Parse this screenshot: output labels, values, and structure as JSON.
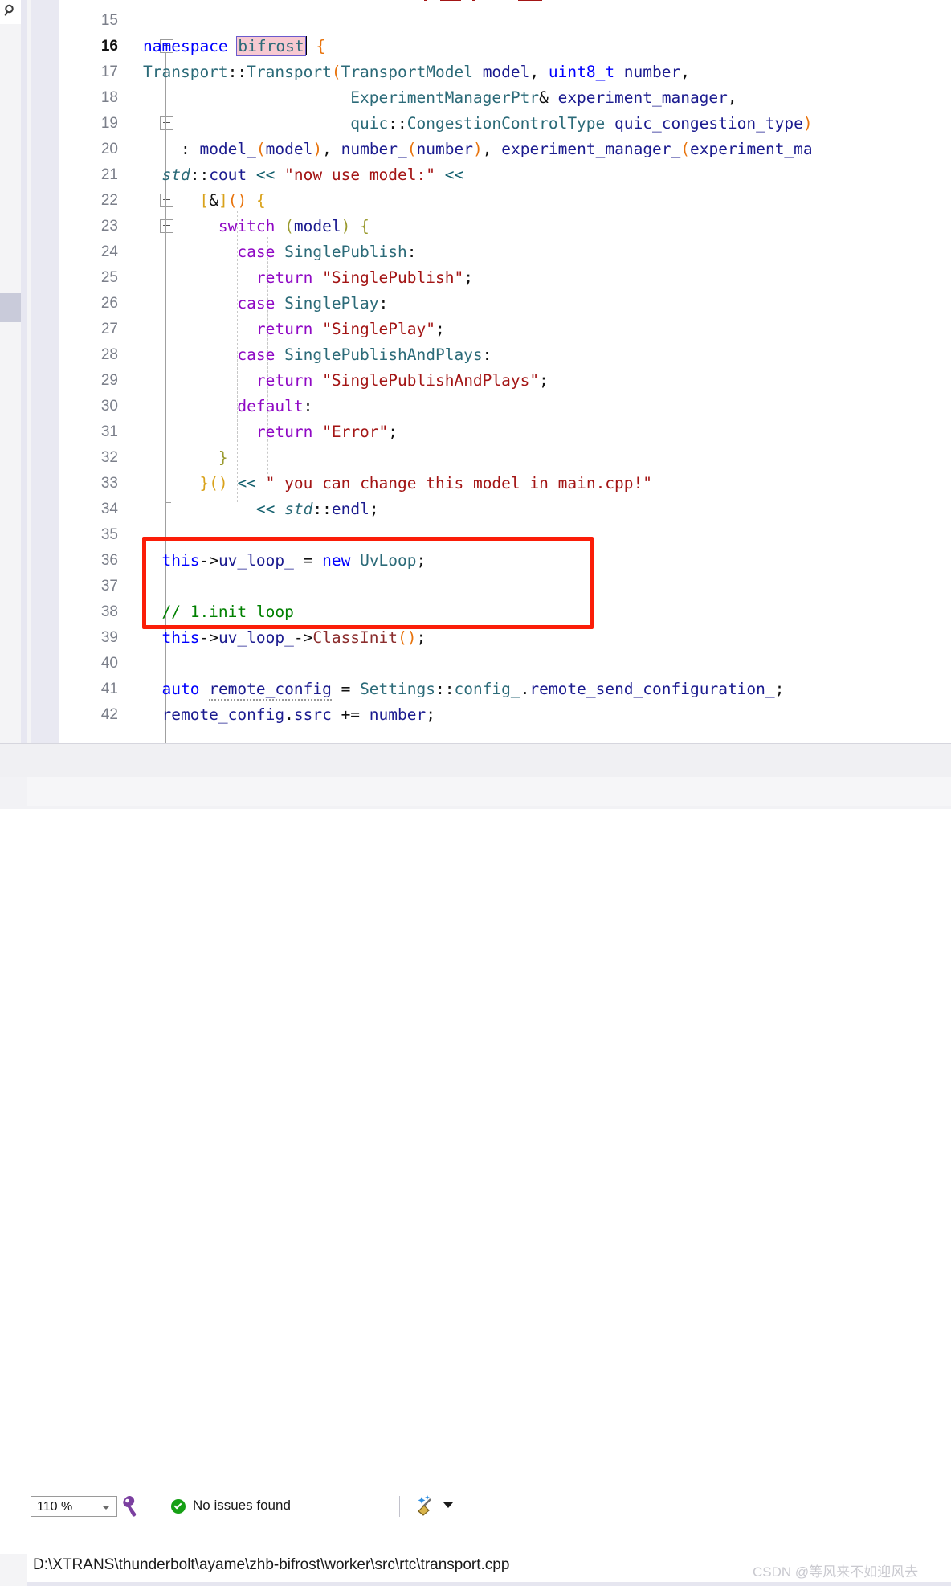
{
  "app": {
    "kind": "code-editor",
    "language": "cpp"
  },
  "left_strip": {
    "search_icon": "search-icon",
    "scrollbar": "vertical-scrollbar"
  },
  "editor": {
    "first_visible_line": 15,
    "current_line": 16,
    "selection_text": "bifrost",
    "lines": [
      {
        "num": "15",
        "segments": []
      },
      {
        "num": "16",
        "segments": [
          {
            "t": "namespace ",
            "c": "kb"
          },
          {
            "t": "bifrost",
            "c": "sel"
          },
          {
            "t": " ",
            "c": "pun"
          },
          {
            "t": "{",
            "c": "par"
          }
        ]
      },
      {
        "num": "17",
        "segments": [
          {
            "t": "Transport",
            "c": "typ"
          },
          {
            "t": "::",
            "c": "pun"
          },
          {
            "t": "Transport",
            "c": "typ"
          },
          {
            "t": "(",
            "c": "par"
          },
          {
            "t": "TransportModel ",
            "c": "typ"
          },
          {
            "t": "model",
            "c": "var"
          },
          {
            "t": ", ",
            "c": "pun"
          },
          {
            "t": "uint8_t ",
            "c": "kb"
          },
          {
            "t": "number",
            "c": "var"
          },
          {
            "t": ",",
            "c": "pun"
          }
        ]
      },
      {
        "num": "18",
        "segments": [
          {
            "t": "                      ",
            "c": "pun"
          },
          {
            "t": "ExperimentManagerPtr",
            "c": "typ"
          },
          {
            "t": "& ",
            "c": "pun"
          },
          {
            "t": "experiment_manager",
            "c": "var"
          },
          {
            "t": ",",
            "c": "pun"
          }
        ]
      },
      {
        "num": "19",
        "segments": [
          {
            "t": "                      ",
            "c": "pun"
          },
          {
            "t": "quic",
            "c": "typ"
          },
          {
            "t": "::",
            "c": "pun"
          },
          {
            "t": "CongestionControlType ",
            "c": "typ"
          },
          {
            "t": "quic_congestion_type",
            "c": "var"
          },
          {
            "t": ")",
            "c": "par"
          }
        ]
      },
      {
        "num": "20",
        "segments": [
          {
            "t": "    : ",
            "c": "pun"
          },
          {
            "t": "model_",
            "c": "var"
          },
          {
            "t": "(",
            "c": "par"
          },
          {
            "t": "model",
            "c": "var"
          },
          {
            "t": ")",
            "c": "par"
          },
          {
            "t": ", ",
            "c": "pun"
          },
          {
            "t": "number_",
            "c": "var"
          },
          {
            "t": "(",
            "c": "par"
          },
          {
            "t": "number",
            "c": "var"
          },
          {
            "t": ")",
            "c": "par"
          },
          {
            "t": ", ",
            "c": "pun"
          },
          {
            "t": "experiment_manager_",
            "c": "var"
          },
          {
            "t": "(",
            "c": "par"
          },
          {
            "t": "experiment_ma",
            "c": "var"
          }
        ]
      },
      {
        "num": "21",
        "segments": [
          {
            "t": "  ",
            "c": "pun"
          },
          {
            "t": "std",
            "c": "typ ital"
          },
          {
            "t": "::",
            "c": "pun"
          },
          {
            "t": "cout",
            "c": "var"
          },
          {
            "t": " ",
            "c": "pun"
          },
          {
            "t": "<<",
            "c": "op"
          },
          {
            "t": " ",
            "c": "pun"
          },
          {
            "t": "\"now use model:\"",
            "c": "str"
          },
          {
            "t": " ",
            "c": "pun"
          },
          {
            "t": "<<",
            "c": "op"
          }
        ]
      },
      {
        "num": "22",
        "segments": [
          {
            "t": "      ",
            "c": "pun"
          },
          {
            "t": "[",
            "c": "br"
          },
          {
            "t": "&",
            "c": "pun"
          },
          {
            "t": "]",
            "c": "br"
          },
          {
            "t": "()",
            "c": "par"
          },
          {
            "t": " ",
            "c": "pun"
          },
          {
            "t": "{",
            "c": "br"
          }
        ]
      },
      {
        "num": "23",
        "segments": [
          {
            "t": "        ",
            "c": "pun"
          },
          {
            "t": "switch",
            "c": "k"
          },
          {
            "t": " ",
            "c": "pun"
          },
          {
            "t": "(",
            "c": "brg"
          },
          {
            "t": "model",
            "c": "var"
          },
          {
            "t": ")",
            "c": "brg"
          },
          {
            "t": " ",
            "c": "pun"
          },
          {
            "t": "{",
            "c": "brg"
          }
        ]
      },
      {
        "num": "24",
        "segments": [
          {
            "t": "          ",
            "c": "pun"
          },
          {
            "t": "case",
            "c": "k"
          },
          {
            "t": " ",
            "c": "pun"
          },
          {
            "t": "SinglePublish",
            "c": "typ"
          },
          {
            "t": ":",
            "c": "pun"
          }
        ]
      },
      {
        "num": "25",
        "segments": [
          {
            "t": "            ",
            "c": "pun"
          },
          {
            "t": "return",
            "c": "k"
          },
          {
            "t": " ",
            "c": "pun"
          },
          {
            "t": "\"SinglePublish\"",
            "c": "str"
          },
          {
            "t": ";",
            "c": "pun"
          }
        ]
      },
      {
        "num": "26",
        "segments": [
          {
            "t": "          ",
            "c": "pun"
          },
          {
            "t": "case",
            "c": "k"
          },
          {
            "t": " ",
            "c": "pun"
          },
          {
            "t": "SinglePlay",
            "c": "typ"
          },
          {
            "t": ":",
            "c": "pun"
          }
        ]
      },
      {
        "num": "27",
        "segments": [
          {
            "t": "            ",
            "c": "pun"
          },
          {
            "t": "return",
            "c": "k"
          },
          {
            "t": " ",
            "c": "pun"
          },
          {
            "t": "\"SinglePlay\"",
            "c": "str"
          },
          {
            "t": ";",
            "c": "pun"
          }
        ]
      },
      {
        "num": "28",
        "segments": [
          {
            "t": "          ",
            "c": "pun"
          },
          {
            "t": "case",
            "c": "k"
          },
          {
            "t": " ",
            "c": "pun"
          },
          {
            "t": "SinglePublishAndPlays",
            "c": "typ"
          },
          {
            "t": ":",
            "c": "pun"
          }
        ]
      },
      {
        "num": "29",
        "segments": [
          {
            "t": "            ",
            "c": "pun"
          },
          {
            "t": "return",
            "c": "k"
          },
          {
            "t": " ",
            "c": "pun"
          },
          {
            "t": "\"SinglePublishAndPlays\"",
            "c": "str"
          },
          {
            "t": ";",
            "c": "pun"
          }
        ]
      },
      {
        "num": "30",
        "segments": [
          {
            "t": "          ",
            "c": "pun"
          },
          {
            "t": "default",
            "c": "k"
          },
          {
            "t": ":",
            "c": "pun"
          }
        ]
      },
      {
        "num": "31",
        "segments": [
          {
            "t": "            ",
            "c": "pun"
          },
          {
            "t": "return",
            "c": "k"
          },
          {
            "t": " ",
            "c": "pun"
          },
          {
            "t": "\"Error\"",
            "c": "str"
          },
          {
            "t": ";",
            "c": "pun"
          }
        ]
      },
      {
        "num": "32",
        "segments": [
          {
            "t": "        ",
            "c": "pun"
          },
          {
            "t": "}",
            "c": "brg"
          }
        ]
      },
      {
        "num": "33",
        "segments": [
          {
            "t": "      ",
            "c": "pun"
          },
          {
            "t": "}()",
            "c": "br"
          },
          {
            "t": " ",
            "c": "pun"
          },
          {
            "t": "<<",
            "c": "op"
          },
          {
            "t": " ",
            "c": "pun"
          },
          {
            "t": "\" you can change this model in main.cpp!\"",
            "c": "str"
          }
        ]
      },
      {
        "num": "34",
        "segments": [
          {
            "t": "            ",
            "c": "pun"
          },
          {
            "t": "<<",
            "c": "op"
          },
          {
            "t": " ",
            "c": "pun"
          },
          {
            "t": "std",
            "c": "typ ital"
          },
          {
            "t": "::",
            "c": "pun"
          },
          {
            "t": "endl",
            "c": "var"
          },
          {
            "t": ";",
            "c": "pun"
          }
        ]
      },
      {
        "num": "35",
        "segments": []
      },
      {
        "num": "36",
        "segments": [
          {
            "t": "  ",
            "c": "pun"
          },
          {
            "t": "this",
            "c": "kb"
          },
          {
            "t": "->",
            "c": "pun"
          },
          {
            "t": "uv_loop_",
            "c": "var"
          },
          {
            "t": " = ",
            "c": "pun"
          },
          {
            "t": "new",
            "c": "kb"
          },
          {
            "t": " ",
            "c": "pun"
          },
          {
            "t": "UvLoop",
            "c": "typ"
          },
          {
            "t": ";",
            "c": "pun"
          }
        ]
      },
      {
        "num": "37",
        "segments": []
      },
      {
        "num": "38",
        "segments": [
          {
            "t": "  ",
            "c": "pun"
          },
          {
            "t": "// 1.init loop",
            "c": "cmt"
          }
        ]
      },
      {
        "num": "39",
        "segments": [
          {
            "t": "  ",
            "c": "pun"
          },
          {
            "t": "this",
            "c": "kb"
          },
          {
            "t": "->",
            "c": "pun"
          },
          {
            "t": "uv_loop_",
            "c": "var"
          },
          {
            "t": "->",
            "c": "pun"
          },
          {
            "t": "ClassInit",
            "c": "fn"
          },
          {
            "t": "()",
            "c": "par"
          },
          {
            "t": ";",
            "c": "pun"
          }
        ]
      },
      {
        "num": "40",
        "segments": []
      },
      {
        "num": "41",
        "segments": [
          {
            "t": "  ",
            "c": "pun"
          },
          {
            "t": "auto",
            "c": "kb"
          },
          {
            "t": " ",
            "c": "pun"
          },
          {
            "t": "remote_config",
            "c": "var squig"
          },
          {
            "t": " = ",
            "c": "pun"
          },
          {
            "t": "Settings",
            "c": "typ"
          },
          {
            "t": "::",
            "c": "pun"
          },
          {
            "t": "config_",
            "c": "typ"
          },
          {
            "t": ".",
            "c": "pun"
          },
          {
            "t": "remote_send_configuration_",
            "c": "var"
          },
          {
            "t": ";",
            "c": "pun"
          }
        ]
      },
      {
        "num": "42",
        "segments": [
          {
            "t": "  ",
            "c": "pun"
          },
          {
            "t": "remote_config",
            "c": "var"
          },
          {
            "t": ".",
            "c": "pun"
          },
          {
            "t": "ssrc",
            "c": "var"
          },
          {
            "t": " += ",
            "c": "pun"
          },
          {
            "t": "number",
            "c": "var"
          },
          {
            "t": ";",
            "c": "pun"
          }
        ]
      }
    ],
    "annotation": {
      "kind": "red-rectangle",
      "color": "#fb1d08",
      "encloses_lines": [
        36,
        37
      ]
    }
  },
  "statusbar": {
    "zoom_level": "110 %",
    "issues_text": "No issues found",
    "issues_status_color": "#16a015",
    "wrench_icon": "wrench-icon",
    "broom_icon": "broom-icon",
    "dropdown_icon": "chevron-down-icon"
  },
  "pathbar": {
    "path": "D:\\XTRANS\\thunderbolt\\ayame\\zhb-bifrost\\worker\\src\\rtc\\transport.cpp",
    "watermark": "CSDN @等风来不如迎风去"
  }
}
